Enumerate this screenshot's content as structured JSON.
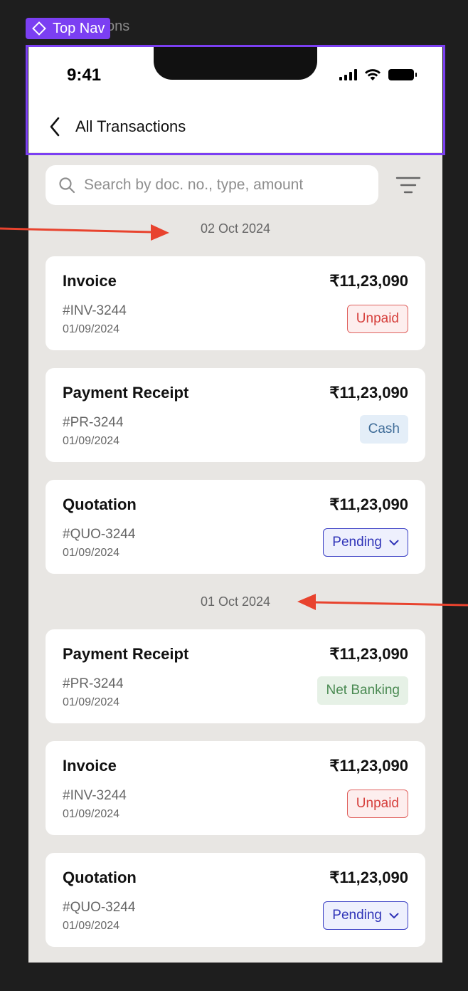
{
  "canvas": {
    "frame_label_partial": "ions",
    "component_tag": "Top Nav"
  },
  "status_bar": {
    "time": "9:41"
  },
  "nav": {
    "title": "All Transactions"
  },
  "search": {
    "placeholder": "Search by doc. no., type, amount"
  },
  "groups": [
    {
      "date": "02 Oct 2024",
      "items": [
        {
          "title": "Invoice",
          "amount": "₹11,23,090",
          "doc_no": "#INV-3244",
          "date": "01/09/2024",
          "badge": "Unpaid"
        },
        {
          "title": "Payment Receipt",
          "amount": "₹11,23,090",
          "doc_no": "#PR-3244",
          "date": "01/09/2024",
          "badge": "Cash"
        },
        {
          "title": "Quotation",
          "amount": "₹11,23,090",
          "doc_no": "#QUO-3244",
          "date": "01/09/2024",
          "badge": "Pending"
        }
      ]
    },
    {
      "date": "01 Oct 2024",
      "items": [
        {
          "title": "Payment Receipt",
          "amount": "₹11,23,090",
          "doc_no": "#PR-3244",
          "date": "01/09/2024",
          "badge": "Net Banking"
        },
        {
          "title": "Invoice",
          "amount": "₹11,23,090",
          "doc_no": "#INV-3244",
          "date": "01/09/2024",
          "badge": "Unpaid"
        },
        {
          "title": "Quotation",
          "amount": "₹11,23,090",
          "doc_no": "#QUO-3244",
          "date": "01/09/2024",
          "badge": "Pending"
        }
      ]
    }
  ],
  "colors": {
    "accent_purple": "#7b3ff2",
    "annotation_arrow": "#e8432e",
    "unpaid": "#d6403d",
    "cash": "#3f6c98",
    "net_banking": "#4a8a52",
    "pending": "#3034b8"
  }
}
